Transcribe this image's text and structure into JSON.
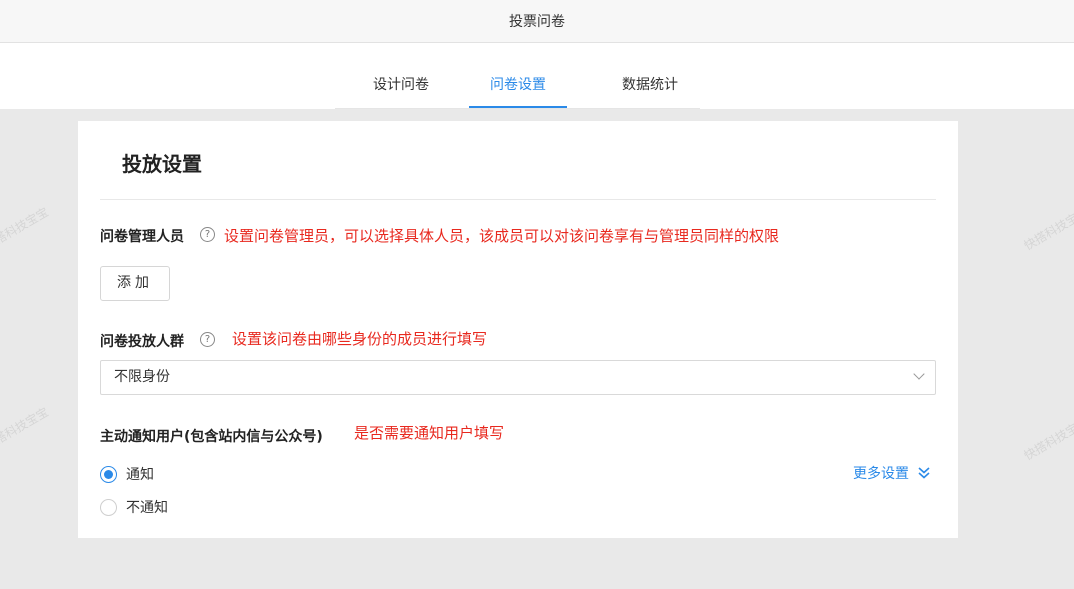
{
  "titlebar": {
    "title": "投票问卷"
  },
  "tabs": [
    {
      "label": "设计问卷"
    },
    {
      "label": "问卷设置"
    },
    {
      "label": "数据统计"
    }
  ],
  "card": {
    "title": "投放设置",
    "managers": {
      "label": "问卷管理人员",
      "help": "?",
      "note": "设置问卷管理员，可以选择具体人员，该成员可以对该问卷享有与管理员同样的权限",
      "add_button": "添加"
    },
    "audience": {
      "label": "问卷投放人群",
      "help": "?",
      "note": "设置该问卷由哪些身份的成员进行填写",
      "selected": "不限身份"
    },
    "notify": {
      "label": "主动通知用户(包含站内信与公众号)",
      "note": "是否需要通知用户填写",
      "options": [
        {
          "label": "通知",
          "checked": true
        },
        {
          "label": "不通知",
          "checked": false
        }
      ],
      "more": "更多设置"
    }
  },
  "watermark": "快搭科技宝宝",
  "colors": {
    "accent": "#2b8ae8",
    "note": "#e8291f"
  }
}
